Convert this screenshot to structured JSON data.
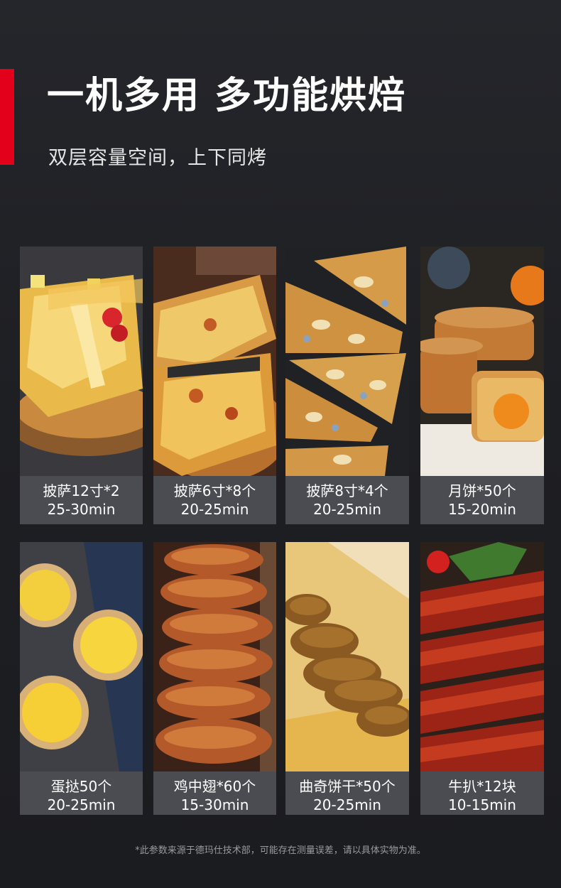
{
  "header": {
    "title": "一机多用 多功能烘焙",
    "subtitle": "双层容量空间，上下同烤"
  },
  "colors": {
    "accent": "#e3001b",
    "background": "#1e1f23",
    "caption_bg": "#4b4c51"
  },
  "items": [
    {
      "name": "披萨12寸*2",
      "time": "25-30min",
      "photo": "pizza-12-inch-photo"
    },
    {
      "name": "披萨6寸*8个",
      "time": "20-25min",
      "photo": "pizza-6-inch-photo"
    },
    {
      "name": "披萨8寸*4个",
      "time": "20-25min",
      "photo": "pizza-8-inch-photo"
    },
    {
      "name": "月饼*50个",
      "time": "15-20min",
      "photo": "mooncake-photo"
    },
    {
      "name": "蛋挞50个",
      "time": "20-25min",
      "photo": "egg-tart-photo"
    },
    {
      "name": "鸡中翅*60个",
      "time": "15-30min",
      "photo": "chicken-wings-photo"
    },
    {
      "name": "曲奇饼干*50个",
      "time": "20-25min",
      "photo": "cookies-photo"
    },
    {
      "name": "牛扒*12块",
      "time": "10-15min",
      "photo": "steak-photo"
    }
  ],
  "footnote": "*此参数来源于德玛仕技术部，可能存在测量误差，请以具体实物为准。"
}
